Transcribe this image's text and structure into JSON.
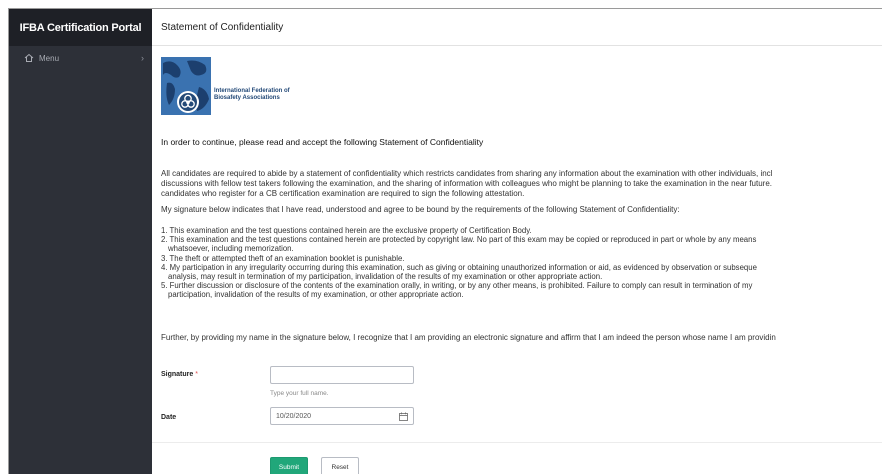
{
  "sidebar": {
    "brand": "IFBA Certification Portal",
    "menu_label": "Menu",
    "menu_icon": "home-icon",
    "chevron": "›"
  },
  "topbar": {
    "title": "Statement of Confidentiality"
  },
  "logo": {
    "line1": "International Federation of",
    "line2": "Biosafety Associations"
  },
  "content": {
    "heading": "In order to continue, please read and accept the following Statement of Confidentiality",
    "para1_lines": [
      "All candidates are required to abide by a statement of confidentiality which restricts candidates from sharing any information about the examination with other individuals, incl",
      "discussions with fellow test takers following the examination, and the sharing of information with colleagues who might be planning to take the examination in the near future.",
      "candidates who register for a CB certification examination are required to sign the following attestation."
    ],
    "para2": "My signature below indicates that I have read, understood and agree to be bound by the requirements of the following Statement of Confidentiality:",
    "list": [
      {
        "line": "1. This examination and the test questions contained herein are the exclusive property of Certification Body.",
        "cont": ""
      },
      {
        "line": "2. This examination and the test questions contained herein are protected by copyright law. No part of this exam may be copied or reproduced in part or whole by any means",
        "cont": "whatsoever, including memorization."
      },
      {
        "line": "3. The theft or attempted theft of an examination booklet is punishable.",
        "cont": ""
      },
      {
        "line": "4. My participation in any irregularity occurring during this examination, such as giving or obtaining unauthorized information or aid, as evidenced by observation or subseque",
        "cont": "analysis, may result in termination of my participation, invalidation of the results of my examination or other appropriate action."
      },
      {
        "line": "5. Further discussion or disclosure of the contents of the examination orally, in writing, or by any other means, is prohibited. Failure to comply can result in termination of my",
        "cont": "participation, invalidation of the results of my examination, or other appropriate action."
      }
    ],
    "para3": "Further, by providing my name in the signature below, I recognize that I am providing an electronic signature and affirm that I am indeed the person whose name I am providin"
  },
  "form": {
    "signature_label": "Signature",
    "required_mark": "*",
    "signature_value": "",
    "signature_help": "Type your full name.",
    "date_label": "Date",
    "date_value": "10/20/2020",
    "calendar_icon": "calendar-icon",
    "submit_label": "Submit",
    "reset_label": "Reset"
  },
  "colors": {
    "sidebar_bg": "#2d3038",
    "sidebar_brand_bg": "#1e2026",
    "submit_bg": "#21a77a",
    "required": "#e05050"
  }
}
